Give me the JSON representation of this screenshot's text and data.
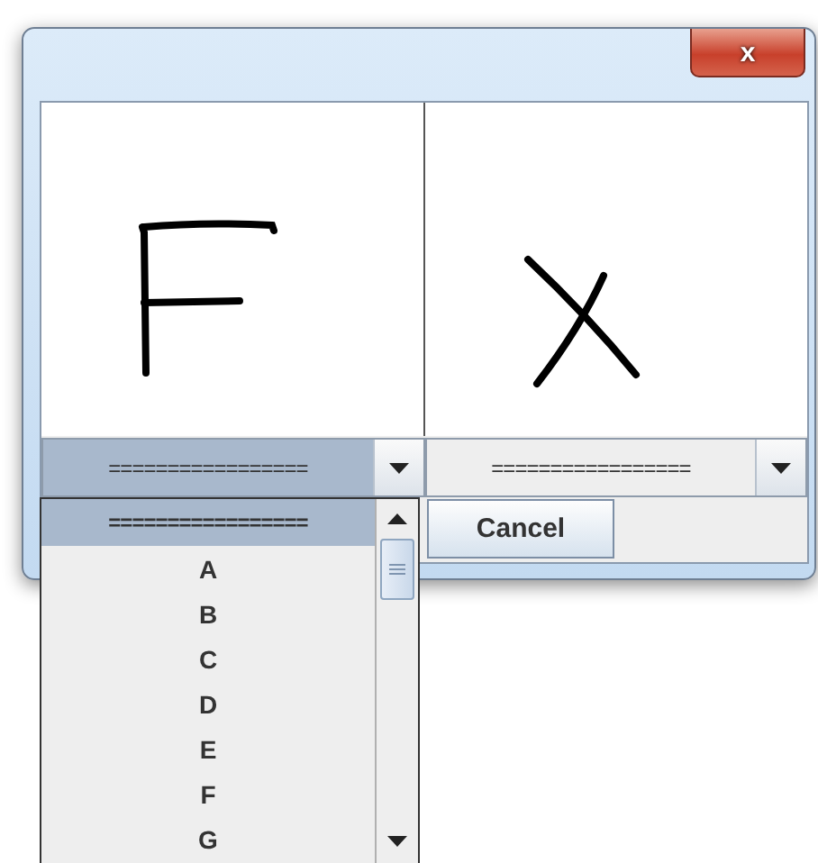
{
  "window": {
    "close_button": "x"
  },
  "panels": [
    {
      "combo": {
        "value": "=================",
        "open": true
      }
    },
    {
      "combo": {
        "value": "=================",
        "open": false
      }
    }
  ],
  "buttons": [
    "Cancel"
  ],
  "dropdown_list": {
    "items": [
      {
        "label": "=================",
        "selected": true
      },
      {
        "label": "A",
        "selected": false
      },
      {
        "label": "B",
        "selected": false
      },
      {
        "label": "C",
        "selected": false
      },
      {
        "label": "D",
        "selected": false
      },
      {
        "label": "E",
        "selected": false
      },
      {
        "label": "F",
        "selected": false
      },
      {
        "label": "G",
        "selected": false
      }
    ]
  }
}
